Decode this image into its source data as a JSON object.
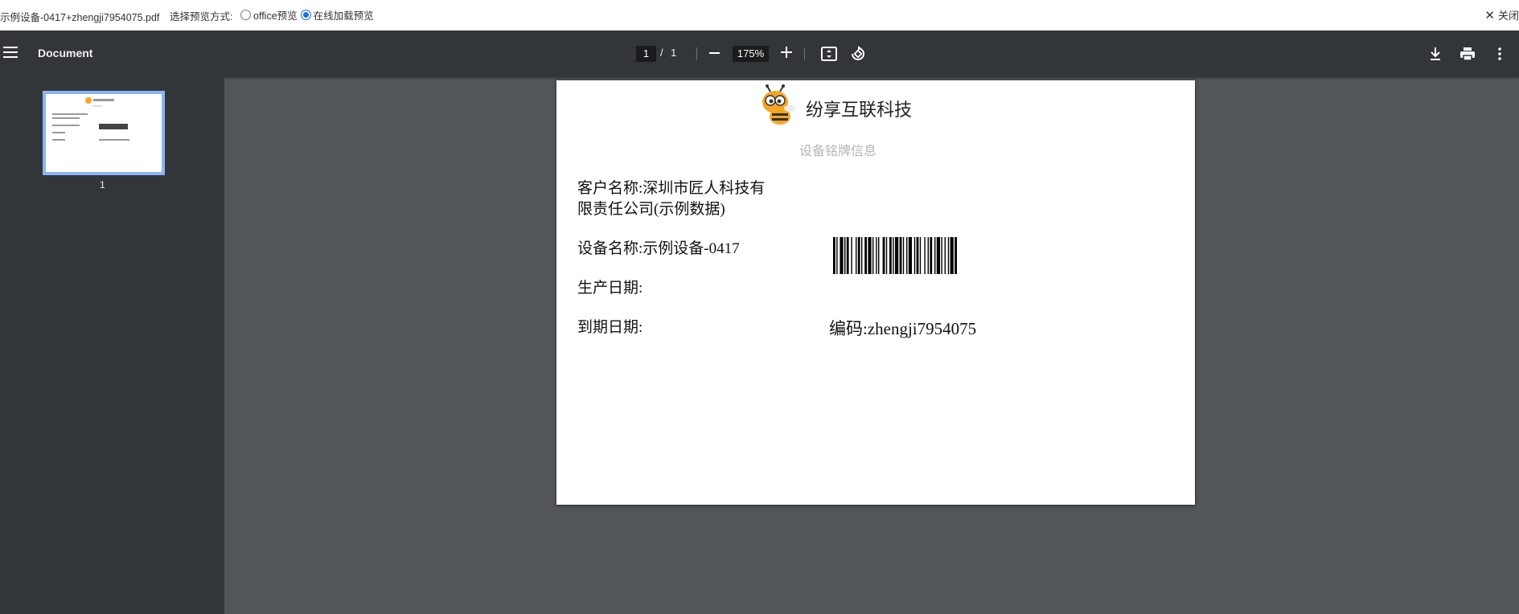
{
  "topbar": {
    "filename": "示例设备-0417+zhengji7954075.pdf",
    "mode_label": "选择预览方式:",
    "options": [
      {
        "label": "office预览",
        "selected": false
      },
      {
        "label": "在线加载预览",
        "selected": true
      }
    ],
    "close_label": "关闭"
  },
  "toolbar": {
    "title": "Document",
    "current_page": "1",
    "page_separator": "/",
    "total_pages": "1",
    "zoom": "175%",
    "icons": [
      "menu-icon",
      "zoom-out-icon",
      "zoom-in-icon",
      "fit-page-icon",
      "rotate-icon",
      "download-icon",
      "print-icon",
      "more-vert-icon"
    ]
  },
  "sidebar": {
    "thumbnail_label": "1"
  },
  "document": {
    "company": "纷享互联科技",
    "subtitle": "设备铭牌信息",
    "customer_line1": "客户名称:深圳市匠人科技有",
    "customer_line2": "限责任公司(示例数据)",
    "device_name": "设备名称:示例设备-0417",
    "production_date": "生产日期:",
    "expiry_date": "到期日期:",
    "code": "编码:zhengji7954075"
  },
  "colors": {
    "toolbar_bg": "#323639",
    "viewer_bg": "#525659",
    "thumbnail_border": "#8ab4f8",
    "radio_accent": "#1f6fe0",
    "logo_orange": "#f5a623"
  }
}
